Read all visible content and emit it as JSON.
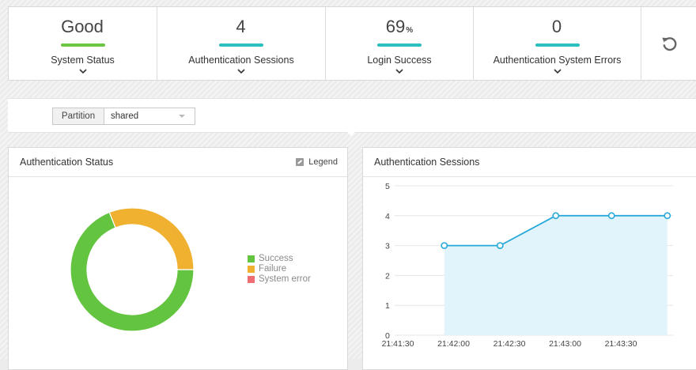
{
  "stats": [
    {
      "value": "Good",
      "unit": "",
      "label": "System Status",
      "color": "#6cc644"
    },
    {
      "value": "4",
      "unit": "",
      "label": "Authentication Sessions",
      "color": "#2bbfbf"
    },
    {
      "value": "69",
      "unit": "%",
      "label": "Login Success",
      "color": "#2bbfbf"
    },
    {
      "value": "0",
      "unit": "",
      "label": "Authentication System Errors",
      "color": "#2bbfbf"
    }
  ],
  "refresh_icon": "refresh-icon",
  "partition": {
    "label": "Partition",
    "value": "shared"
  },
  "auth_status": {
    "title": "Authentication Status",
    "legend_toggle": "Legend",
    "legend": [
      {
        "label": "Success",
        "color": "#63c43f"
      },
      {
        "label": "Failure",
        "color": "#f0b030"
      },
      {
        "label": "System error",
        "color": "#ee6e73"
      }
    ]
  },
  "auth_sessions": {
    "title": "Authentication Sessions"
  },
  "chart_data": [
    {
      "type": "pie",
      "title": "Authentication Status",
      "categories": [
        "Success",
        "Failure",
        "System error"
      ],
      "values": [
        69,
        31,
        0
      ],
      "colors": [
        "#63c43f",
        "#f0b030",
        "#ee6e73"
      ],
      "donut": true,
      "legend": "right"
    },
    {
      "type": "area",
      "title": "Authentication Sessions",
      "x": [
        "21:41:55",
        "21:42:25",
        "21:42:55",
        "21:43:25",
        "21:43:55"
      ],
      "values": [
        3,
        3,
        4,
        4,
        4
      ],
      "xticks": [
        "21:41:30",
        "21:42:00",
        "21:42:30",
        "21:43:00",
        "21:43:30"
      ],
      "yticks": [
        0,
        1,
        2,
        3,
        4,
        5
      ],
      "ylim": [
        0,
        5
      ],
      "grid": true,
      "line_color": "#27a9d9",
      "fill_color": "#e2f4fb"
    }
  ]
}
